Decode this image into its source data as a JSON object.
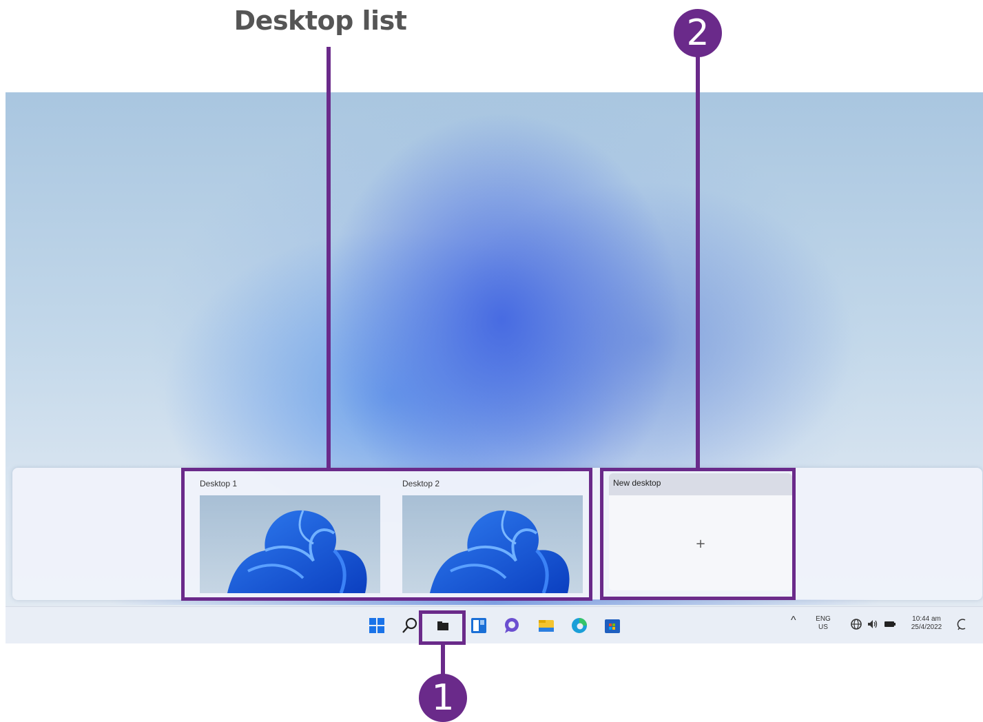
{
  "annotations": {
    "title": "Desktop list",
    "badge_1": "1",
    "badge_2": "2",
    "color": "#6a2a8a"
  },
  "task_view": {
    "desktops": [
      {
        "label": "Desktop 1"
      },
      {
        "label": "Desktop 2"
      }
    ],
    "new_desktop": {
      "label": "New desktop",
      "plus": "+"
    }
  },
  "taskbar": {
    "icons": [
      "windows-start-icon",
      "search-icon",
      "task-view-icon",
      "widgets-icon",
      "chat-icon",
      "file-explorer-icon",
      "edge-icon",
      "store-icon"
    ],
    "tray": {
      "chevron": "^",
      "language_top": "ENG",
      "language_bottom": "US",
      "time": "10:44 am",
      "date": "25/4/2022"
    }
  },
  "colors": {
    "annotation_purple": "#6a2a8a",
    "windows_blue": "#1a73e8"
  }
}
